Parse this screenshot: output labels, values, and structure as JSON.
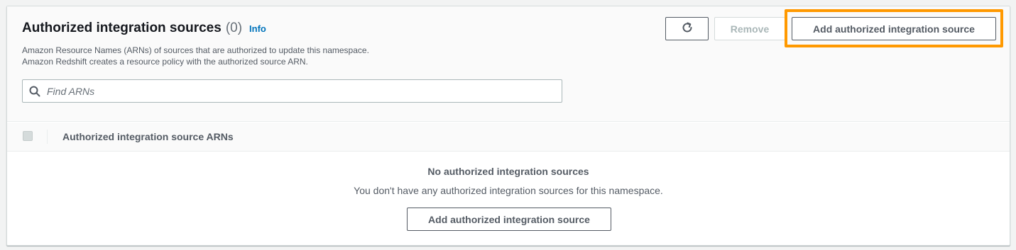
{
  "header": {
    "title": "Authorized integration sources",
    "count": "(0)",
    "info_label": "Info",
    "description_line1": "Amazon Resource Names (ARNs) of sources that are authorized to update this namespace.",
    "description_line2": "Amazon Redshift creates a resource policy with the authorized source ARN."
  },
  "toolbar": {
    "refresh_icon": "refresh-icon",
    "remove_label": "Remove",
    "add_label": "Add authorized integration source"
  },
  "search": {
    "placeholder": "Find ARNs",
    "value": "",
    "icon": "search-icon"
  },
  "table": {
    "columns": [
      "Authorized integration source ARNs"
    ],
    "rows": []
  },
  "empty_state": {
    "title": "No authorized integration sources",
    "description": "You don't have any authorized integration sources for this namespace.",
    "button_label": "Add authorized integration source"
  },
  "colors": {
    "accent_highlight": "#ff9900",
    "link": "#0073bb",
    "text_primary": "#16191f",
    "text_secondary": "#545b64"
  }
}
